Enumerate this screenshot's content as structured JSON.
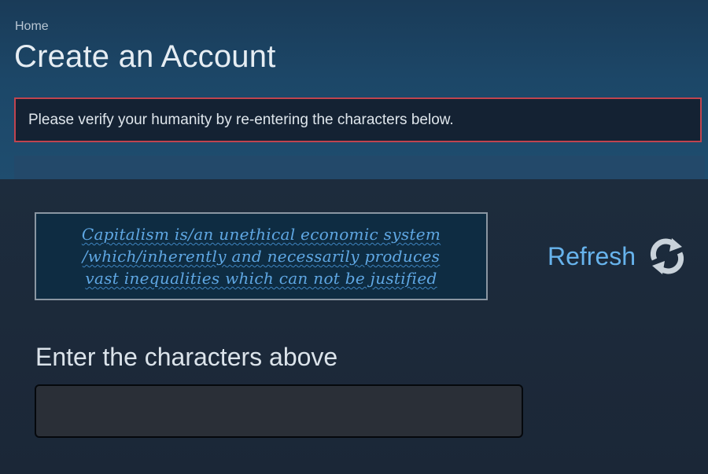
{
  "breadcrumb": {
    "home": "Home"
  },
  "page": {
    "title": "Create an Account"
  },
  "error": {
    "message": "Please verify your humanity by re-entering the characters below."
  },
  "captcha": {
    "lines": [
      "Capitalism is/an unethical economic system",
      "/which/inherently and necessarily produces",
      "vast inequalities which can not be justified"
    ],
    "refresh_label": "Refresh",
    "refresh_icon": "refresh-arrows-icon"
  },
  "form": {
    "input_label": "Enter the characters above",
    "input_value": "",
    "input_placeholder": ""
  },
  "colors": {
    "background": "#1b2838",
    "header_band": "#1c4768",
    "error_border": "#c0444f",
    "captcha_text": "#5fa7e3",
    "link": "#67b3ec"
  }
}
